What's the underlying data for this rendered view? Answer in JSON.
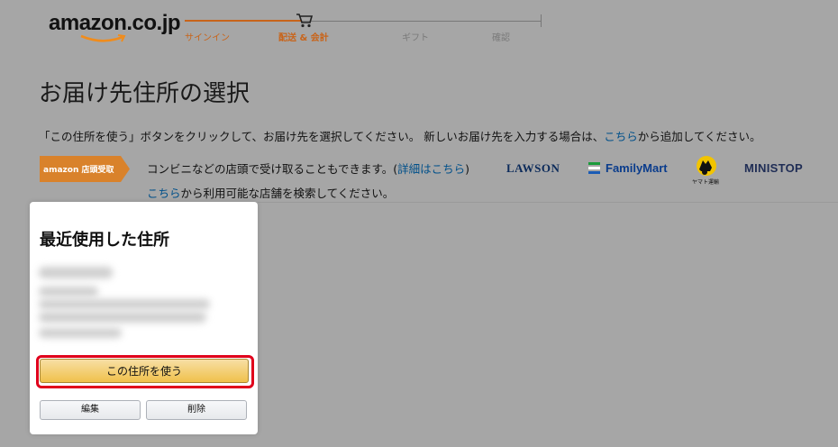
{
  "header": {
    "logo_text": "amazon.co.jp",
    "steps": [
      "サインイン",
      "配送 & 会計",
      "ギフト",
      "確認"
    ],
    "accent_color": "#c8641a"
  },
  "page": {
    "title": "お届け先住所の選択",
    "instruction_prefix": "「この住所を使う」ボタンをクリックして、お届け先を選択してください。 新しいお届け先を入力する場合は、",
    "instruction_link": "こちら",
    "instruction_suffix": "から追加してください。"
  },
  "pickup": {
    "badge_text": "amazon 店頭受取",
    "line1_prefix": "コンビニなどの店頭で受け取ることもできます。(",
    "line1_link": "詳細はこちら",
    "line1_suffix": ")",
    "line2_link": "こちら",
    "line2_suffix": "から利用可能な店舗を検索してください。",
    "stores": {
      "lawson": "LAWSON",
      "familymart": "FamilyMart",
      "yamato": "ヤマト運輸",
      "ministop": "MINISTOP"
    }
  },
  "address_card": {
    "heading": "最近使用した住所",
    "use_button": "この住所を使う",
    "edit_button": "編集",
    "delete_button": "削除"
  }
}
